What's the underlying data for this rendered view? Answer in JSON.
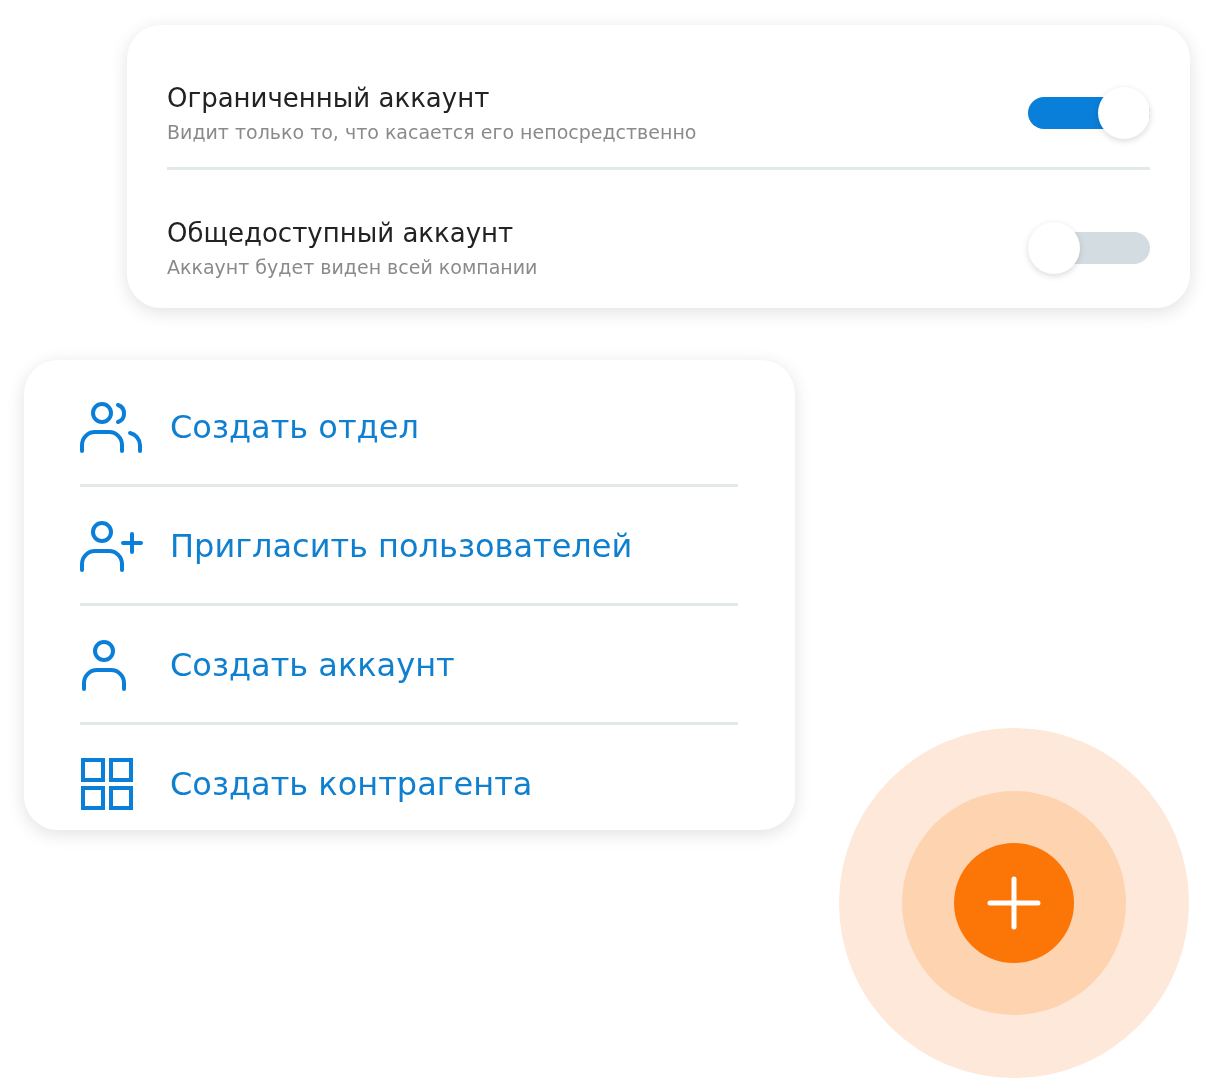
{
  "account_settings": [
    {
      "title": "Ограниченный аккаунт",
      "subtitle": "Видит только то, что касается его непосредственно",
      "on": true
    },
    {
      "title": "Общедоступный аккаунт",
      "subtitle": "Аккаунт будет виден всей компании",
      "on": false
    }
  ],
  "actions_menu": [
    {
      "kind": "group",
      "label": "Создать отдел"
    },
    {
      "kind": "add-user",
      "label": "Пригласить пользователей"
    },
    {
      "kind": "user",
      "label": "Создать аккаунт"
    },
    {
      "kind": "grid",
      "label": "Создать контрагента"
    }
  ]
}
